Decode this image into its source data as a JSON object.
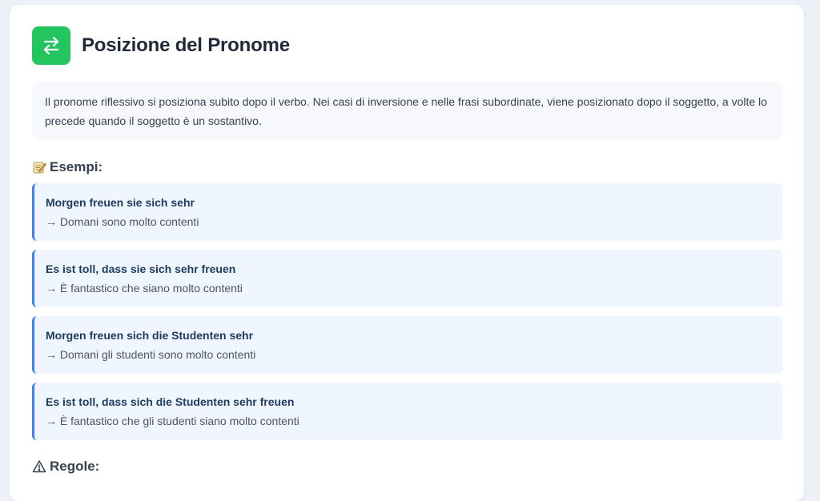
{
  "section": {
    "title": "Posizione del Pronome",
    "icon": "swap-arrows-icon",
    "accent_color": "#22c55e",
    "description": "Il pronome riflessivo si posiziona subito dopo il verbo. Nei casi di inversione e nelle frasi subordinate, viene posizionato dopo il soggetto, a volte lo precede quando il soggetto è un sostantivo."
  },
  "examples": {
    "heading": "Esempi:",
    "icon": "memo-icon",
    "items": [
      {
        "german": "Morgen freuen sie sich sehr",
        "translation": "→ Domani sono molto contenti"
      },
      {
        "german": "Es ist toll, dass sie sich sehr freuen",
        "translation": "→ È fantastico che siano molto contenti"
      },
      {
        "german": "Morgen freuen sich die Studenten sehr",
        "translation": "→ Domani gli studenti sono molto contenti"
      },
      {
        "german": "Es ist toll, dass sich die Studenten sehr freuen",
        "translation": "→ È fantastico che gli studenti siano molto contenti"
      }
    ]
  },
  "rules": {
    "heading": "Regole:",
    "icon": "warning-icon"
  }
}
